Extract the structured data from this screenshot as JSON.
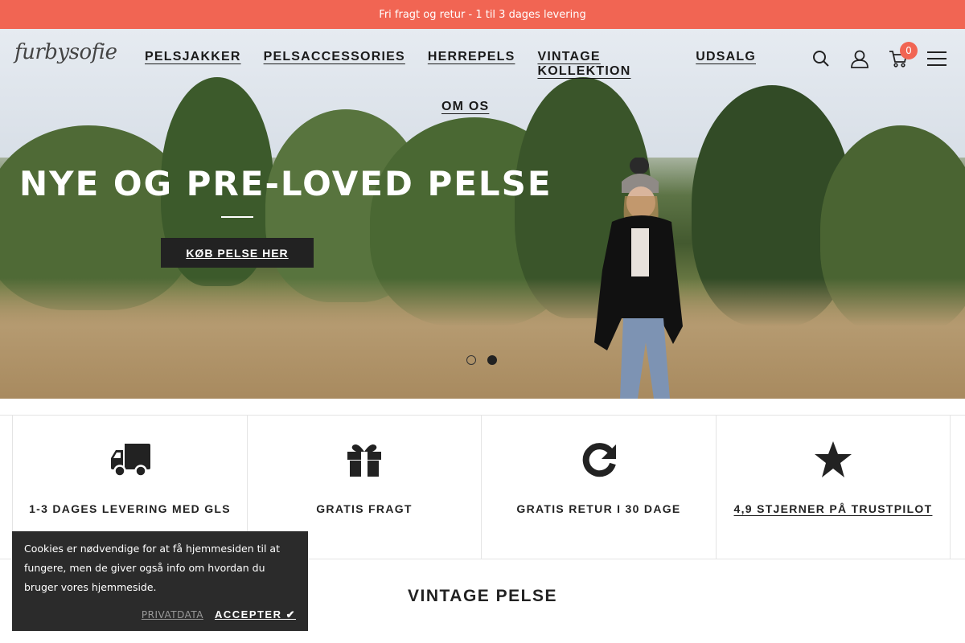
{
  "announcement": "Fri fragt og retur - 1 til 3 dages levering",
  "logo": "furbysofie",
  "nav": {
    "items": [
      "PELSJAKKER",
      "PELSACCESSORIES",
      "HERREPELS",
      "VINTAGE KOLLEKTION",
      "UDSALG"
    ],
    "second_row": "OM OS"
  },
  "header": {
    "cart_count": "0",
    "icons": [
      "search-icon",
      "account-icon",
      "cart-icon",
      "menu-icon"
    ]
  },
  "hero": {
    "title": "NYE OG PRE-LOVED PELSE",
    "button": "KØB PELSE HER",
    "slides": 2,
    "active_slide": 2
  },
  "features": [
    {
      "icon": "truck-icon",
      "label": "1-3 DAGES LEVERING MED GLS"
    },
    {
      "icon": "gift-icon",
      "label": "GRATIS FRAGT"
    },
    {
      "icon": "refresh-icon",
      "label": "GRATIS RETUR I 30 DAGE"
    },
    {
      "icon": "star-icon",
      "label": "4,9 STJERNER PÅ TRUSTPILOT"
    }
  ],
  "section_title": "VINTAGE PELSE",
  "cookie": {
    "text": "Cookies er nødvendige for at få hjemmesiden til at fungere, men de giver også info om hvordan du bruger vores hjemmeside.",
    "privacy": "PRIVATDATA",
    "accept": "ACCEPTER ✔"
  },
  "colors": {
    "accent": "#f16553",
    "dark": "#222222"
  }
}
